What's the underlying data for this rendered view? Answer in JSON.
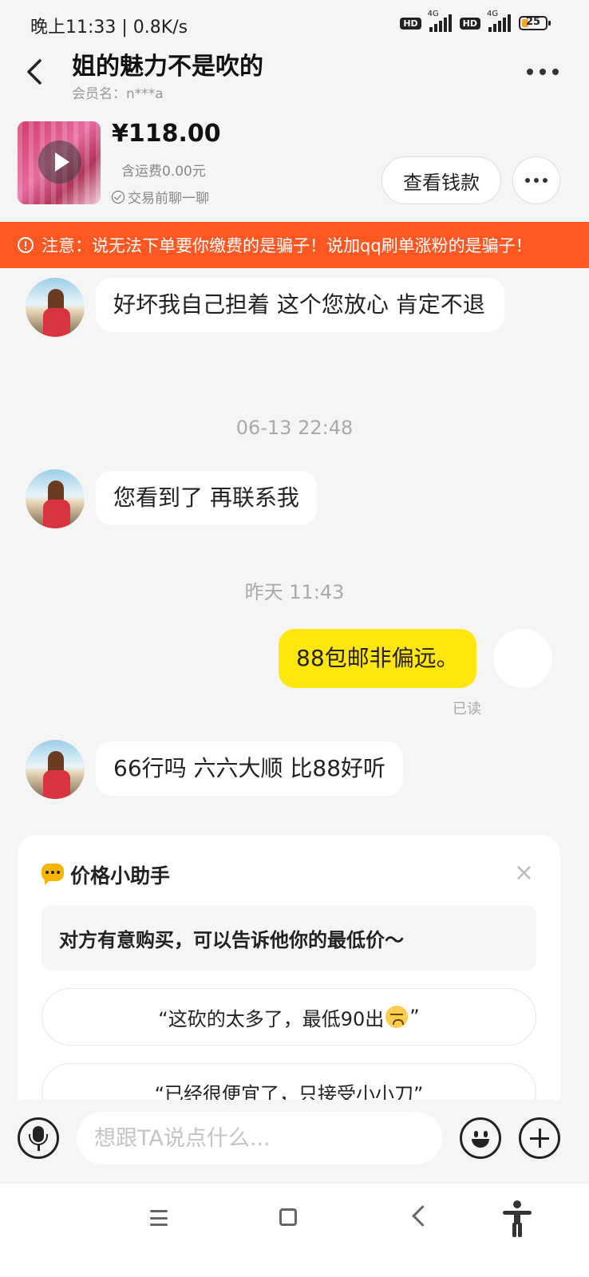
{
  "status_bar": {
    "time_speed": "晚上11:33 | 0.8K/s",
    "hd_label": "HD",
    "network_label": "4G",
    "battery_level": "25"
  },
  "header": {
    "title": "姐的魅力不是吹的",
    "subtitle": "会员名：n***a"
  },
  "product": {
    "price": "¥118.00",
    "shipping": "含运费0.00元",
    "chat_before": "交易前聊一聊",
    "view_payment_label": "查看钱款"
  },
  "warning": {
    "text": "注意：说无法下单要你缴费的是骗子！说加qq刷单涨粉的是骗子！"
  },
  "messages": {
    "m1": "好坏我自己担着 这个您放心 肯定不退",
    "ts1": "06-13 22:48",
    "m2": "您看到了 再联系我",
    "ts2": "昨天 11:43",
    "m3": "88包邮非偏远。",
    "read_status": "已读",
    "m4": "66行吗 六六大顺 比88好听"
  },
  "price_helper": {
    "title": "价格小助手",
    "close": "×",
    "tip": "对方有意购买，可以告诉他你的最低价～",
    "suggestion1_before": "“这砍的太多了，最低90出",
    "suggestion1_after": "”",
    "suggestion2": "“已经很便宜了，只接受小小刀”"
  },
  "input": {
    "placeholder": "想跟TA说点什么..."
  }
}
